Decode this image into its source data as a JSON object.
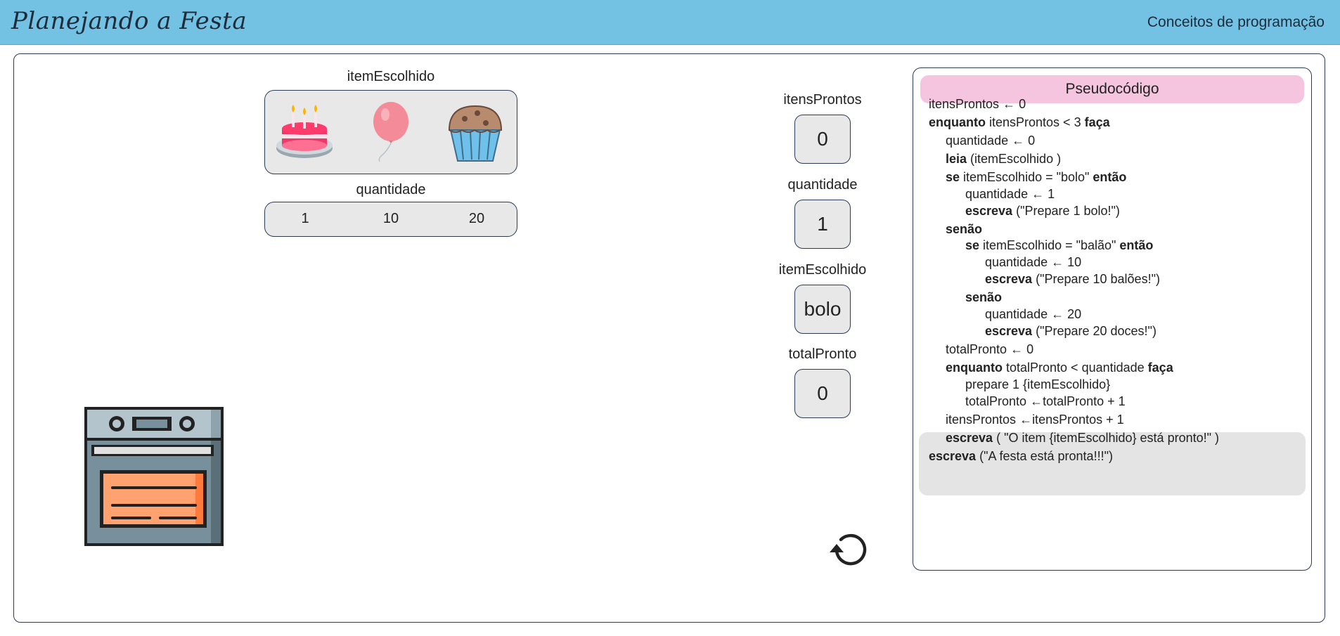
{
  "header": {
    "title": "Planejando a Festa",
    "link": "Conceitos de programação",
    "bg_color": "#73c2e4"
  },
  "choices": {
    "label": "itemEscolhido",
    "items": [
      {
        "name": "bolo",
        "icon": "cake-icon"
      },
      {
        "name": "balão",
        "icon": "balloon-icon"
      },
      {
        "name": "doce",
        "icon": "cupcake-icon"
      }
    ]
  },
  "quantity": {
    "label": "quantidade",
    "options": [
      "1",
      "10",
      "20"
    ]
  },
  "variables": {
    "itensProntos": {
      "label": "itensProntos",
      "value": "0"
    },
    "quantidade": {
      "label": "quantidade",
      "value": "1"
    },
    "itemEscolhido": {
      "label": "itemEscolhido",
      "value": "bolo"
    },
    "totalPronto": {
      "label": "totalPronto",
      "value": "0"
    }
  },
  "reset": {
    "icon": "reset-icon"
  },
  "oven": {
    "icon": "oven-icon"
  },
  "pseudocode": {
    "title": "Pseudocódigo",
    "header_color": "#f5c4df",
    "lines": [
      {
        "indent": 0,
        "parts": [
          {
            "t": "itensProntos ",
            "b": false
          },
          {
            "t": "← 0",
            "b": false
          }
        ]
      },
      {
        "indent": 0,
        "parts": [
          {
            "t": "enquanto",
            "b": true
          },
          {
            "t": " itensProntos < 3 ",
            "b": false
          },
          {
            "t": "faça",
            "b": true
          }
        ]
      },
      {
        "indent": 1,
        "parts": [
          {
            "t": "quantidade ",
            "b": false
          },
          {
            "t": "← 0",
            "b": false
          }
        ]
      },
      {
        "indent": 1,
        "parts": [
          {
            "t": "leia",
            "b": true
          },
          {
            "t": " (itemEscolhido )",
            "b": false
          }
        ]
      },
      {
        "indent": 1,
        "parts": [
          {
            "t": "se",
            "b": true
          },
          {
            "t": " itemEscolhido = \"bolo\" ",
            "b": false
          },
          {
            "t": "então",
            "b": true
          }
        ]
      },
      {
        "indent": 2,
        "parts": [
          {
            "t": "quantidade ",
            "b": false
          },
          {
            "t": "← 1",
            "b": false
          }
        ]
      },
      {
        "indent": 2,
        "parts": [
          {
            "t": "escreva",
            "b": true
          },
          {
            "t": " (\"Prepare 1 bolo!\")",
            "b": false
          }
        ]
      },
      {
        "indent": 1,
        "parts": [
          {
            "t": "senão",
            "b": true
          }
        ]
      },
      {
        "indent": 2,
        "parts": [
          {
            "t": "se",
            "b": true
          },
          {
            "t": " itemEscolhido = \"balão\" ",
            "b": false
          },
          {
            "t": "então",
            "b": true
          }
        ]
      },
      {
        "indent": 3,
        "parts": [
          {
            "t": "quantidade ",
            "b": false
          },
          {
            "t": "← 10",
            "b": false
          }
        ]
      },
      {
        "indent": 3,
        "parts": [
          {
            "t": "escreva",
            "b": true
          },
          {
            "t": " (\"Prepare 10 balões!\")",
            "b": false
          }
        ]
      },
      {
        "indent": 2,
        "parts": [
          {
            "t": "senão",
            "b": true
          }
        ]
      },
      {
        "indent": 3,
        "parts": [
          {
            "t": "quantidade ",
            "b": false
          },
          {
            "t": "← 20",
            "b": false
          }
        ]
      },
      {
        "indent": 3,
        "parts": [
          {
            "t": "escreva",
            "b": true
          },
          {
            "t": " (\"Prepare 20 doces!\")",
            "b": false
          }
        ]
      },
      {
        "indent": 1,
        "parts": [
          {
            "t": "totalPronto ",
            "b": false
          },
          {
            "t": "← 0",
            "b": false
          }
        ]
      },
      {
        "indent": 1,
        "parts": [
          {
            "t": "enquanto",
            "b": true
          },
          {
            "t": " totalPronto < quantidade ",
            "b": false
          },
          {
            "t": "faça",
            "b": true
          }
        ],
        "highlighted": true
      },
      {
        "indent": 2,
        "parts": [
          {
            "t": "prepare 1 {itemEscolhido}",
            "b": false
          }
        ],
        "highlighted": true
      },
      {
        "indent": 2,
        "parts": [
          {
            "t": "totalPronto ",
            "b": false
          },
          {
            "t": "←totalPronto + 1",
            "b": false
          }
        ],
        "highlighted": true
      },
      {
        "indent": 1,
        "parts": [
          {
            "t": "itensProntos ",
            "b": false
          },
          {
            "t": "←itensProntos + 1",
            "b": false
          }
        ]
      },
      {
        "indent": 1,
        "parts": [
          {
            "t": "escreva",
            "b": true
          },
          {
            "t": " ( \"O item {itemEscolhido} está pronto!\" )",
            "b": false
          }
        ]
      },
      {
        "indent": 0,
        "parts": [
          {
            "t": "escreva",
            "b": true
          },
          {
            "t": " (\"A festa está pronta!!!\")",
            "b": false
          }
        ]
      }
    ]
  }
}
